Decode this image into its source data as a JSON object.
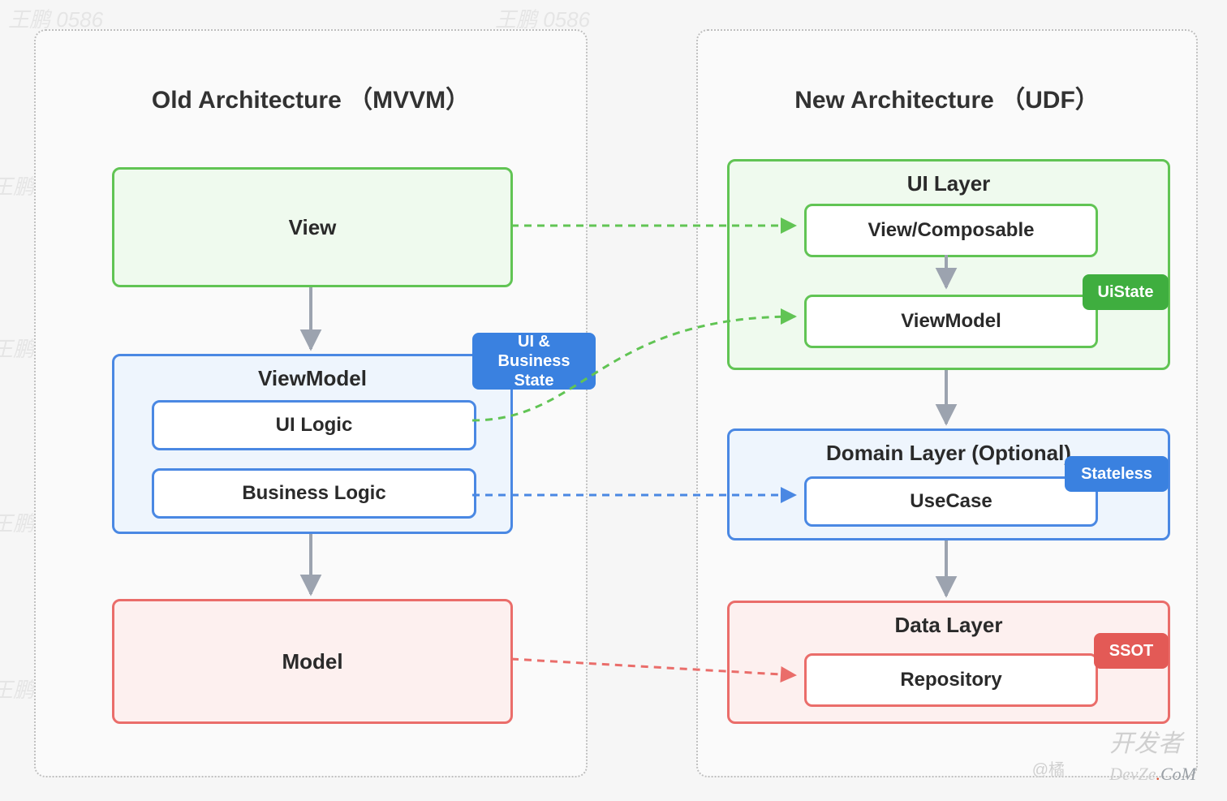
{
  "left": {
    "title": "Old Architecture （MVVM）",
    "view": "View",
    "viewmodel": {
      "title": "ViewModel",
      "badge": "UI & Business State",
      "ui_logic": "UI Logic",
      "business_logic": "Business Logic"
    },
    "model": "Model"
  },
  "right": {
    "title": "New Architecture （UDF）",
    "ui_layer": {
      "title": "UI Layer",
      "view_composable": "View/Composable",
      "viewmodel": "ViewModel",
      "ui_state_badge": "UiState"
    },
    "domain_layer": {
      "title": "Domain Layer (Optional)",
      "usecase": "UseCase",
      "stateless_badge": "Stateless"
    },
    "data_layer": {
      "title": "Data Layer",
      "repository": "Repository",
      "ssot_badge": "SSOT"
    }
  },
  "watermarks": {
    "repeat": "王鹏 0586",
    "attribution": "@橘",
    "footer_main": "开发者",
    "footer_prefix": "DevZe",
    "footer_dot": ".",
    "footer_tail": "CoM"
  },
  "colors": {
    "green": "#61c454",
    "blue": "#4a88e3",
    "red": "#ea6d6a",
    "grey": "#9ca3af"
  }
}
